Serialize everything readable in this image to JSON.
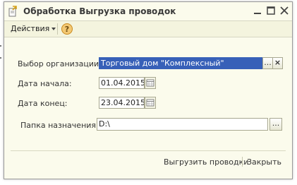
{
  "window": {
    "title": "Обработка  Выгрузка проводок",
    "icons": [
      "document-arrow-icon",
      "minimize-icon",
      "maximize-icon",
      "close-icon"
    ]
  },
  "menubar": {
    "actions_label": "Действия",
    "help_icon": "question-circle-icon"
  },
  "form": {
    "organization": {
      "label": "Выбор организации:",
      "value": "Торговый дом \"Комплексный\""
    },
    "date_start": {
      "label": "Дата начала:",
      "value": "01.04.2015"
    },
    "date_end": {
      "label": "Дата конец:",
      "value": "23.04.2015"
    },
    "folder": {
      "label": "Папка назначения:",
      "value": "D:\\"
    },
    "select_button": "...",
    "clear_button": "×"
  },
  "footer": {
    "export_label": "Выгрузить проводки",
    "close_label": "Закрыть"
  },
  "colors": {
    "window_bg": "#fbfbec",
    "selection": "#3760b8",
    "help_icon": "#e8a640"
  }
}
